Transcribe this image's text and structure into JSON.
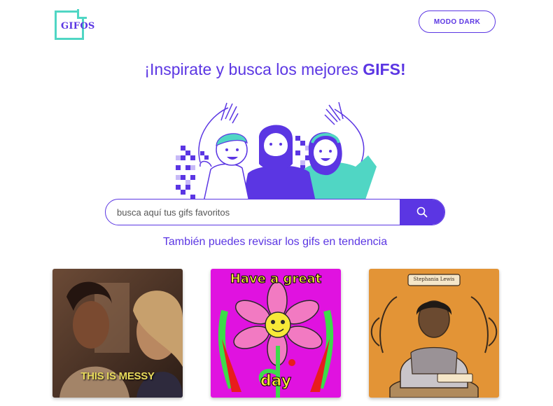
{
  "logo": {
    "text": "GIFOS"
  },
  "header": {
    "dark_mode_label": "MODO DARK"
  },
  "hero": {
    "headline_prefix": "¡Inspirate y busca los mejores ",
    "headline_highlight": "GIFS!"
  },
  "search": {
    "placeholder": "busca aquí tus gifs favoritos",
    "icon": "search-icon"
  },
  "trending_text": "También puedes revisar los gifs en tendencia",
  "gifs": [
    {
      "caption": "THIS IS MESSY"
    },
    {
      "caption_top": "Have a great",
      "caption_bottom": "day"
    },
    {
      "caption": "Stephania Lewis"
    }
  ],
  "colors": {
    "brand": "#5b36e3",
    "accent": "#50d6c4"
  }
}
